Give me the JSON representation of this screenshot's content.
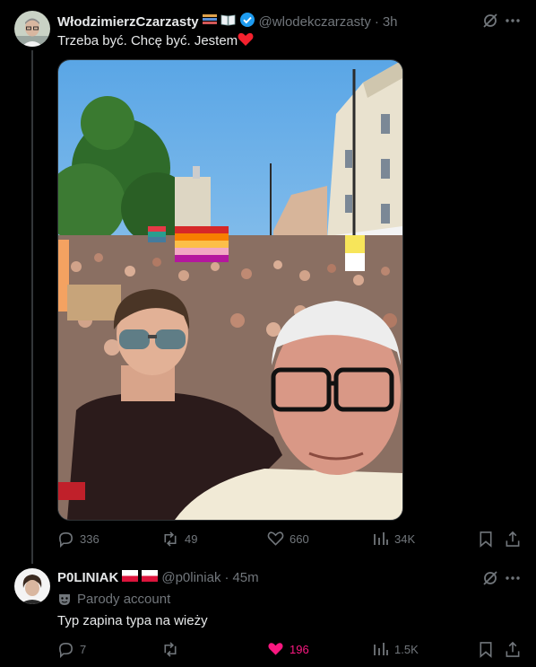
{
  "tweet": {
    "author_name": "WłodzimierzCzarzasty",
    "handle": "@wlodekczarzasty",
    "time": "3h",
    "text": "Trzeba być. Chcę być. Jestem",
    "emoji_after_text": "heart",
    "icons": [
      "grok-icon",
      "more-icon"
    ],
    "stats": {
      "replies": "336",
      "reposts": "49",
      "likes": "660",
      "views": "34K"
    }
  },
  "reply": {
    "author_name": "P0LINIAK",
    "handle": "@p0liniak",
    "time": "45m",
    "parody_label": "Parody account",
    "text": "Typ zapina typa na wieży",
    "stats": {
      "replies": "7",
      "reposts": "",
      "likes": "196",
      "views": "1.5K"
    },
    "liked": true
  },
  "colors": {
    "background": "#000000",
    "text": "#e7e9ea",
    "muted": "#71767b",
    "verified": "#1d9bf0",
    "like_active": "#f91880",
    "heart": "#f4212e"
  }
}
